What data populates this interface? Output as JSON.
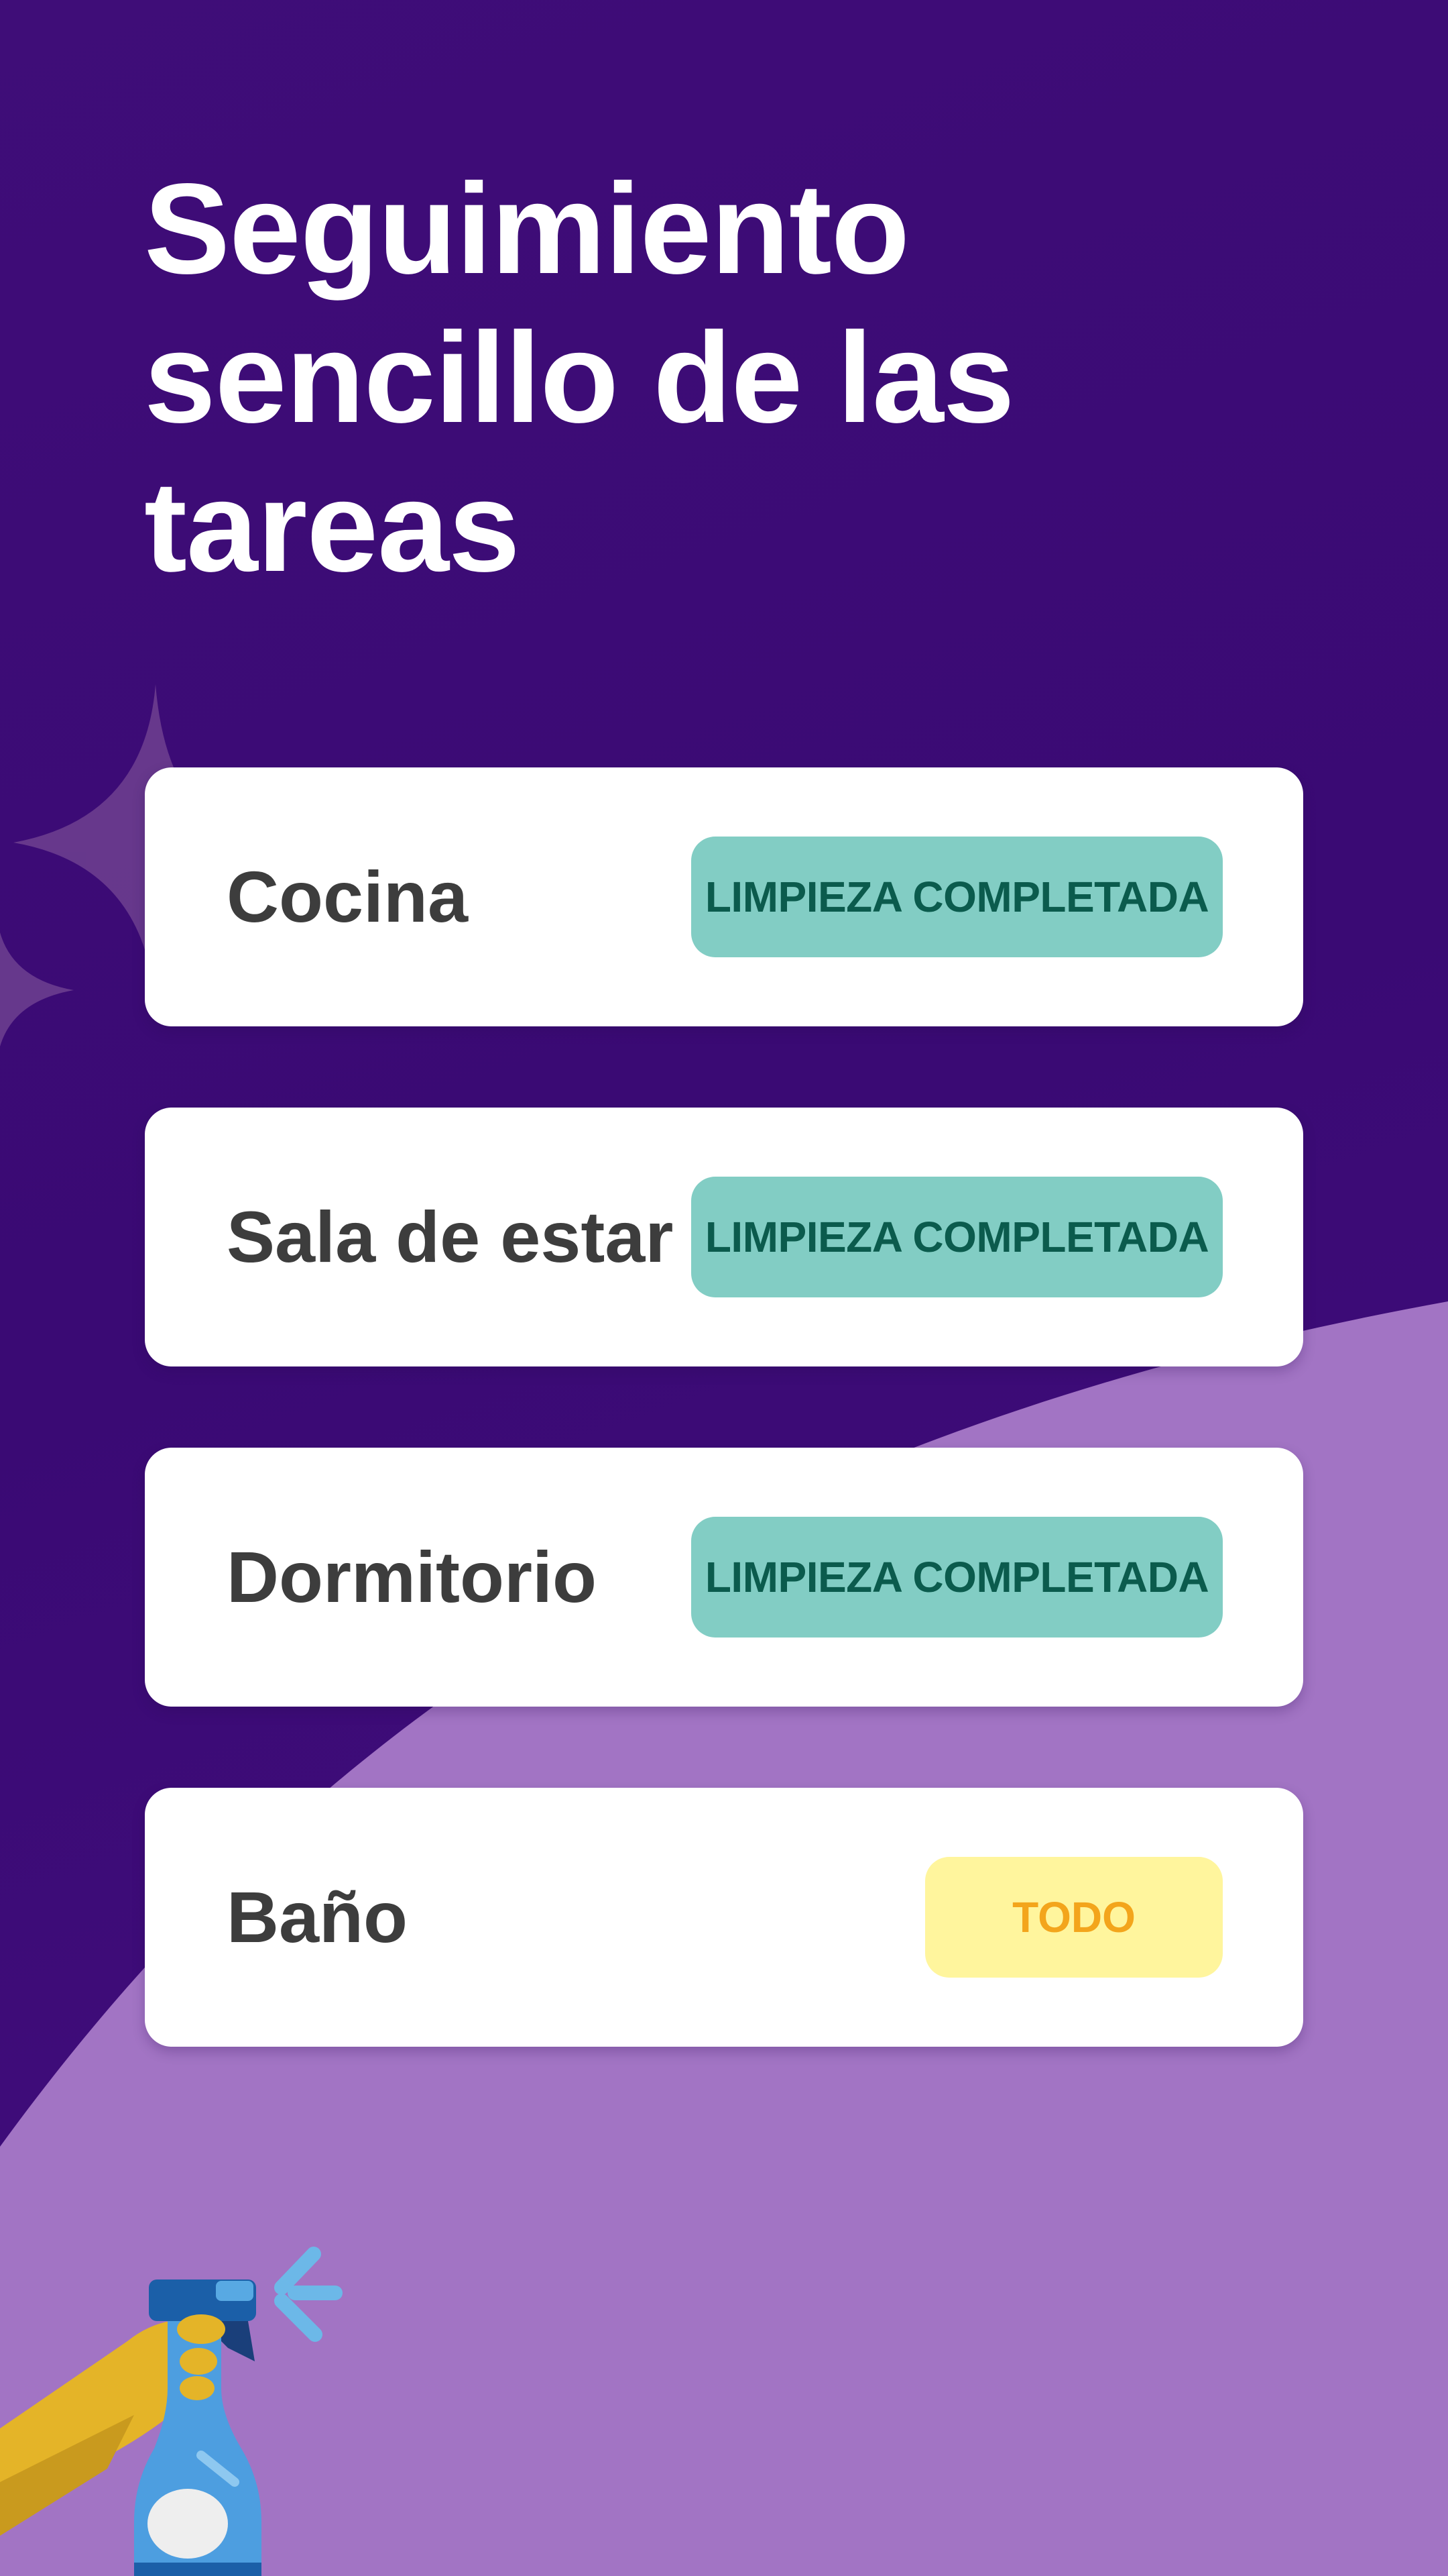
{
  "header": {
    "title": "Seguimiento sencillo de las tareas"
  },
  "tasks": [
    {
      "room": "Cocina",
      "status": "LIMPIEZA COMPLETADA",
      "state": "done"
    },
    {
      "room": "Sala de estar",
      "status": "LIMPIEZA COMPLETADA",
      "state": "done"
    },
    {
      "room": "Dormitorio",
      "status": "LIMPIEZA COMPLETADA",
      "state": "done"
    },
    {
      "room": "Baño",
      "status": "TODO",
      "state": "todo"
    }
  ],
  "colors": {
    "background_top": "#3f0d78",
    "background_wave": "#a274c4",
    "card": "#ffffff",
    "done_badge_bg": "#82cdc4",
    "done_badge_text": "#0b5b4d",
    "todo_badge_bg": "#fff59d",
    "todo_badge_text": "#f3a51c",
    "room_text": "#3d3d3d"
  },
  "icons": [
    "sparkle-icon",
    "spray-bottle-icon"
  ]
}
